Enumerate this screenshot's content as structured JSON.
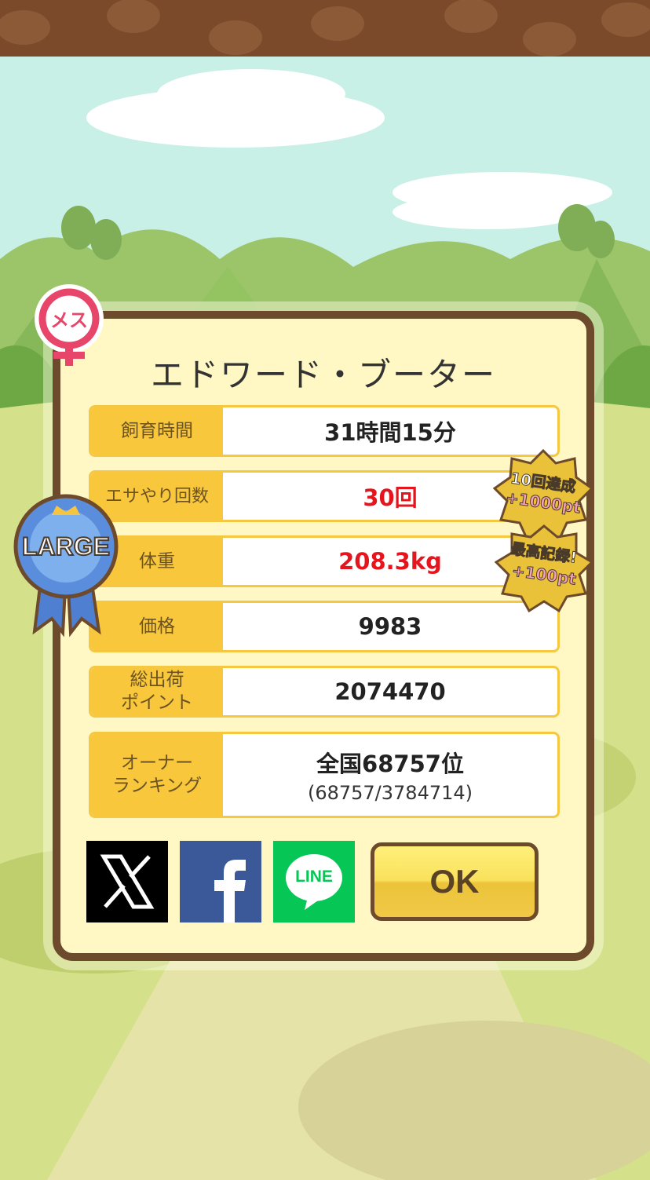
{
  "title": "エドワード・ブーター",
  "gender_badge": "メス",
  "size_ribbon": "LARGE",
  "rows": [
    {
      "label": "飼育時間",
      "value": "31時間15分",
      "highlight": false
    },
    {
      "label": "エサやり回数",
      "value": "30回",
      "highlight": true
    },
    {
      "label": "体重",
      "value": "208.3kg",
      "highlight": true
    },
    {
      "label": "価格",
      "value": "9983",
      "highlight": false
    },
    {
      "label": "総出荷\nポイント",
      "value": "2074470",
      "highlight": false
    },
    {
      "label": "オーナー\nランキング",
      "value": "全国68757位",
      "sub": "(68757/3784714)",
      "highlight": false
    }
  ],
  "awards": [
    {
      "line1": "10回達成",
      "line2": "+1000pt"
    },
    {
      "line1": "最高記録!",
      "line2": "+100pt"
    }
  ],
  "share": {
    "x_icon": "x-logo-icon",
    "facebook_icon": "facebook-logo-icon",
    "line_label": "LINE"
  },
  "ok_label": "OK",
  "colors": {
    "accent": "#f8c73c",
    "highlight": "#e6141c",
    "frame": "#6e4a2c",
    "panel": "#fff7c4"
  }
}
